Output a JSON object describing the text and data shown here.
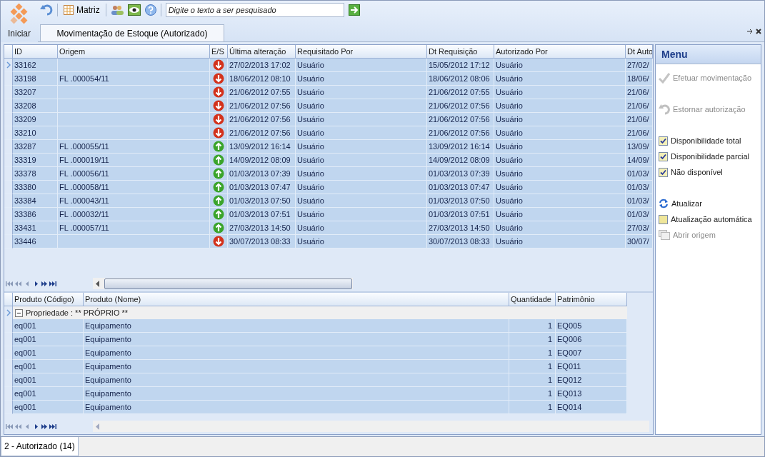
{
  "toolbar": {
    "start_label": "Iniciar",
    "matrix_label": "Matriz",
    "search": {
      "placeholder": "Digite o texto a ser pesquisado"
    }
  },
  "document_tab": {
    "label": "Movimentação de Estoque (Autorizado)",
    "selected": true
  },
  "movements": {
    "columns": [
      "ID",
      "Origem",
      "E/S",
      "Última alteração",
      "Requisitado Por",
      "Dt Requisição",
      "Autorizado Por",
      "Dt Auto"
    ],
    "rows": [
      {
        "id": "33162",
        "kind": "out",
        "updated": "27/02/2013 17:02",
        "requested_by": "Usuário",
        "requested_at": "15/05/2012 17:12",
        "authorized_by": "Usuário",
        "authorized_at": "27/02/",
        "current": true
      },
      {
        "id": "33198",
        "origin": "FL .000054/11",
        "kind": "out",
        "updated": "18/06/2012 08:10",
        "requested_by": "Usuário",
        "requested_at": "18/06/2012 08:06",
        "authorized_by": "Usuário",
        "authorized_at": "18/06/",
        "current": false
      },
      {
        "id": "33207",
        "kind": "out",
        "updated": "21/06/2012 07:55",
        "requested_by": "Usuário",
        "requested_at": "21/06/2012 07:55",
        "authorized_by": "Usuário",
        "authorized_at": "21/06/",
        "current": false
      },
      {
        "id": "33208",
        "kind": "out",
        "updated": "21/06/2012 07:56",
        "requested_by": "Usuário",
        "requested_at": "21/06/2012 07:56",
        "authorized_by": "Usuário",
        "authorized_at": "21/06/",
        "current": false
      },
      {
        "id": "33209",
        "kind": "out",
        "updated": "21/06/2012 07:56",
        "requested_by": "Usuário",
        "requested_at": "21/06/2012 07:56",
        "authorized_by": "Usuário",
        "authorized_at": "21/06/",
        "current": false
      },
      {
        "id": "33210",
        "kind": "out",
        "updated": "21/06/2012 07:56",
        "requested_by": "Usuário",
        "requested_at": "21/06/2012 07:56",
        "authorized_by": "Usuário",
        "authorized_at": "21/06/",
        "current": false
      },
      {
        "id": "33287",
        "origin": "FL .000055/11",
        "kind": "in",
        "updated": "13/09/2012 16:14",
        "requested_by": "Usuário",
        "requested_at": "13/09/2012 16:14",
        "authorized_by": "Usuário",
        "authorized_at": "13/09/",
        "current": false
      },
      {
        "id": "33319",
        "origin": "FL .000019/11",
        "kind": "in",
        "updated": "14/09/2012 08:09",
        "requested_by": "Usuário",
        "requested_at": "14/09/2012 08:09",
        "authorized_by": "Usuário",
        "authorized_at": "14/09/",
        "current": false
      },
      {
        "id": "33378",
        "origin": "FL .000056/11",
        "kind": "in",
        "updated": "01/03/2013 07:39",
        "requested_by": "Usuário",
        "requested_at": "01/03/2013 07:39",
        "authorized_by": "Usuário",
        "authorized_at": "01/03/",
        "current": false
      },
      {
        "id": "33380",
        "origin": "FL .000058/11",
        "kind": "in",
        "updated": "01/03/2013 07:47",
        "requested_by": "Usuário",
        "requested_at": "01/03/2013 07:47",
        "authorized_by": "Usuário",
        "authorized_at": "01/03/",
        "current": false
      },
      {
        "id": "33384",
        "origin": "FL .000043/11",
        "kind": "in",
        "updated": "01/03/2013 07:50",
        "requested_by": "Usuário",
        "requested_at": "01/03/2013 07:50",
        "authorized_by": "Usuário",
        "authorized_at": "01/03/",
        "current": false
      },
      {
        "id": "33386",
        "origin": "FL .000032/11",
        "kind": "in",
        "updated": "01/03/2013 07:51",
        "requested_by": "Usuário",
        "requested_at": "01/03/2013 07:51",
        "authorized_by": "Usuário",
        "authorized_at": "01/03/",
        "current": false
      },
      {
        "id": "33431",
        "origin": "FL .000057/11",
        "kind": "in",
        "updated": "27/03/2013 14:50",
        "requested_by": "Usuário",
        "requested_at": "27/03/2013 14:50",
        "authorized_by": "Usuário",
        "authorized_at": "27/03/",
        "current": false
      },
      {
        "id": "33446",
        "kind": "out",
        "updated": "30/07/2013 08:33",
        "requested_by": "Usuário",
        "requested_at": "30/07/2013 08:33",
        "authorized_by": "Usuário",
        "authorized_at": "30/07/",
        "current": false
      }
    ]
  },
  "items": {
    "columns": [
      "Produto (Código)",
      "Produto (Nome)",
      "Quantidade",
      "Patrimônio"
    ],
    "group": {
      "label": "Propriedade : ** PRÓPRIO **",
      "expanded": true
    },
    "rows": [
      {
        "code": "eq001",
        "name": "Equipamento",
        "quantity": "1",
        "asset": "EQ005"
      },
      {
        "code": "eq001",
        "name": "Equipamento",
        "quantity": "1",
        "asset": "EQ006"
      },
      {
        "code": "eq001",
        "name": "Equipamento",
        "quantity": "1",
        "asset": "EQ007"
      },
      {
        "code": "eq001",
        "name": "Equipamento",
        "quantity": "1",
        "asset": "EQ011"
      },
      {
        "code": "eq001",
        "name": "Equipamento",
        "quantity": "1",
        "asset": "EQ012"
      },
      {
        "code": "eq001",
        "name": "Equipamento",
        "quantity": "1",
        "asset": "EQ013"
      },
      {
        "code": "eq001",
        "name": "Equipamento",
        "quantity": "1",
        "asset": "EQ014"
      }
    ]
  },
  "menu": {
    "title": "Menu",
    "items": [
      {
        "kind": "confirm",
        "label": "Efetuar movimentação",
        "disabled": true
      },
      {
        "kind": "revert",
        "label": "Estornar autorização",
        "disabled": true
      },
      {
        "kind": "checkbox",
        "label": "Disponibilidade total",
        "checked": true
      },
      {
        "kind": "checkbox",
        "label": "Disponibilidade parcial",
        "checked": true
      },
      {
        "kind": "checkbox",
        "label": "Não disponível",
        "checked": true
      },
      {
        "kind": "refresh",
        "label": "Atualizar",
        "disabled": false
      },
      {
        "kind": "checkbox",
        "label": "Atualização automática",
        "checked": false
      },
      {
        "kind": "open",
        "label": "Abrir origem",
        "disabled": true
      }
    ]
  },
  "status_tab": {
    "label": "2 - Autorizado (14)",
    "selected": true
  }
}
